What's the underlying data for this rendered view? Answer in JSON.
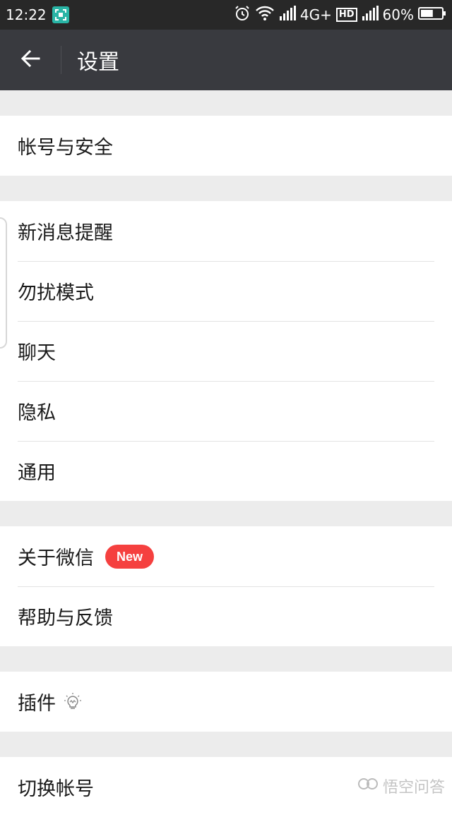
{
  "status_bar": {
    "time": "12:22",
    "network": "4G+",
    "hd": "HD",
    "battery": "60%",
    "battery_level": 0.6
  },
  "header": {
    "title": "设置"
  },
  "groups": [
    {
      "items": [
        {
          "label": "帐号与安全"
        }
      ]
    },
    {
      "items": [
        {
          "label": "新消息提醒"
        },
        {
          "label": "勿扰模式"
        },
        {
          "label": "聊天"
        },
        {
          "label": "隐私"
        },
        {
          "label": "通用"
        }
      ]
    },
    {
      "items": [
        {
          "label": "关于微信",
          "badge": "New"
        },
        {
          "label": "帮助与反馈"
        }
      ]
    },
    {
      "items": [
        {
          "label": "插件",
          "icon": "lightbulb-icon"
        }
      ]
    },
    {
      "items": [
        {
          "label": "切换帐号"
        }
      ]
    }
  ],
  "watermark": {
    "text": "悟空问答"
  },
  "colors": {
    "status_bar": "#282828",
    "title_bar": "#393a3f",
    "background": "#ececec",
    "badge": "#f5403f"
  }
}
